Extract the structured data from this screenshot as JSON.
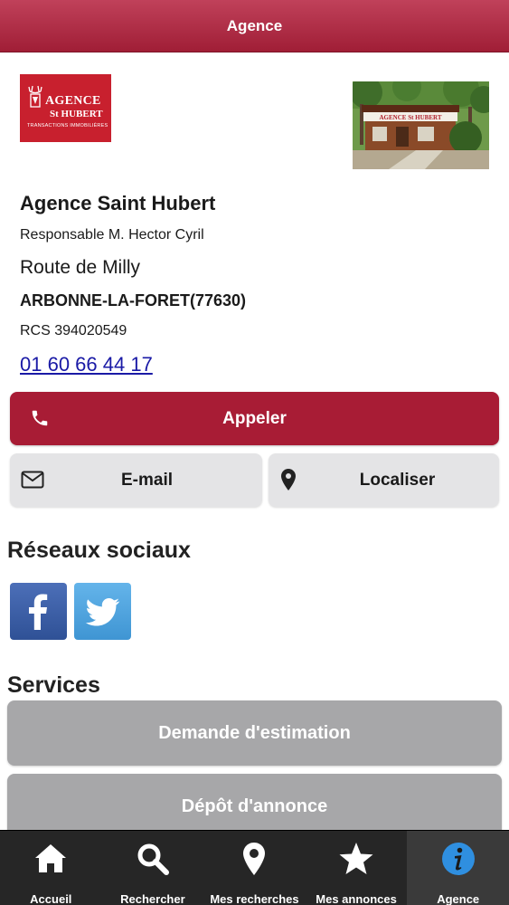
{
  "header": {
    "title": "Agence"
  },
  "logo": {
    "line1": "AGENCE",
    "line2": "St HUBERT",
    "line3": "TRANSACTIONS IMMOBILIÈRES"
  },
  "photo": {
    "sign_text": "AGENCE St HUBERT"
  },
  "agency": {
    "name": "Agence Saint Hubert",
    "responsable": "Responsable M. Hector Cyril",
    "street": "Route de Milly",
    "city": "ARBONNE-LA-FORET(77630)",
    "rcs": "RCS 394020549",
    "phone": "01 60 66 44 17"
  },
  "actions": {
    "call_label": "Appeler",
    "email_label": "E-mail",
    "locate_label": "Localiser"
  },
  "social": {
    "title": "Réseaux sociaux",
    "items": [
      {
        "name": "facebook-icon",
        "color": "#3b5998"
      },
      {
        "name": "twitter-icon",
        "color": "#55acee"
      }
    ]
  },
  "services": {
    "title": "Services",
    "items": [
      "Demande d'estimation",
      "Dépôt d'annonce"
    ]
  },
  "tabbar": {
    "tabs": [
      "Accueil",
      "Rechercher",
      "Mes recherches",
      "Mes annonces",
      "Agence"
    ],
    "active_index": 4
  },
  "colors": {
    "brand": "#a81c35",
    "tab_active_icon": "#2f8fe0",
    "link": "#1a1aa6"
  }
}
